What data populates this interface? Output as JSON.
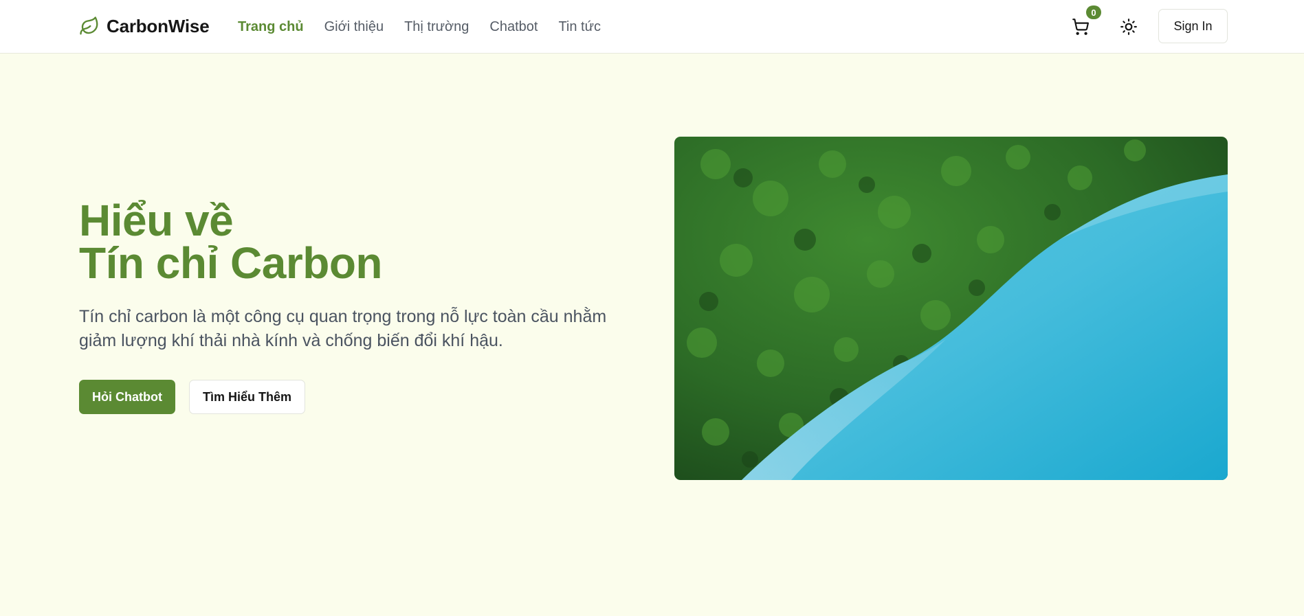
{
  "brand": {
    "name": "CarbonWise",
    "icon": "leaf-icon",
    "accent_color": "#5b8a33"
  },
  "nav": {
    "items": [
      {
        "label": "Trang chủ",
        "active": true
      },
      {
        "label": "Giới thiệu",
        "active": false
      },
      {
        "label": "Thị trường",
        "active": false
      },
      {
        "label": "Chatbot",
        "active": false
      },
      {
        "label": "Tin tức",
        "active": false
      }
    ]
  },
  "header_actions": {
    "cart": {
      "icon": "cart-icon",
      "count": "0"
    },
    "theme_toggle": {
      "icon": "sun-icon"
    },
    "signin_label": "Sign In"
  },
  "hero": {
    "title_line1": "Hiểu về",
    "title_line2": "Tín chỉ Carbon",
    "description": "Tín chỉ carbon là một công cụ quan trọng trong nỗ lực toàn cầu nhằm giảm lượng khí thải nhà kính và chống biến đổi khí hậu.",
    "primary_button": "Hỏi Chatbot",
    "secondary_button": "Tìm Hiểu Thêm"
  },
  "colors": {
    "page_background": "#fbfdec",
    "header_background": "#ffffff",
    "text_muted": "#555c66",
    "forest": "#2f6a2a",
    "water": "#3bb6d6"
  }
}
